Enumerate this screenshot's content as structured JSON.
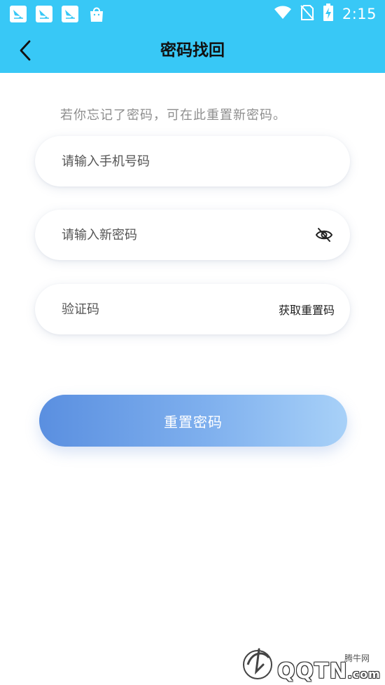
{
  "status_bar": {
    "time": "2:15",
    "icons": [
      "app-notification-icon",
      "app-notification-icon",
      "app-notification-icon",
      "shopping-bag-icon",
      "wifi-icon",
      "no-sim-icon",
      "battery-charging-icon"
    ]
  },
  "app_bar": {
    "title": "密码找回",
    "back_icon": "chevron-left-icon"
  },
  "form": {
    "hint": "若你忘记了密码，可在此重置新密码。",
    "phone_placeholder": "请输入手机号码",
    "password_placeholder": "请输入新密码",
    "password_toggle_icon": "eye-off-icon",
    "code_placeholder": "验证码",
    "get_code_label": "获取重置码",
    "submit_label": "重置密码"
  },
  "watermark": {
    "brand_small": "腾牛网",
    "brand_text": "QQTN",
    "brand_suffix": ".com"
  },
  "colors": {
    "header": "#38c8f6",
    "button_start": "#5a8fe0",
    "button_end": "#a8d1f8",
    "hint_text": "#8e8e8e"
  }
}
